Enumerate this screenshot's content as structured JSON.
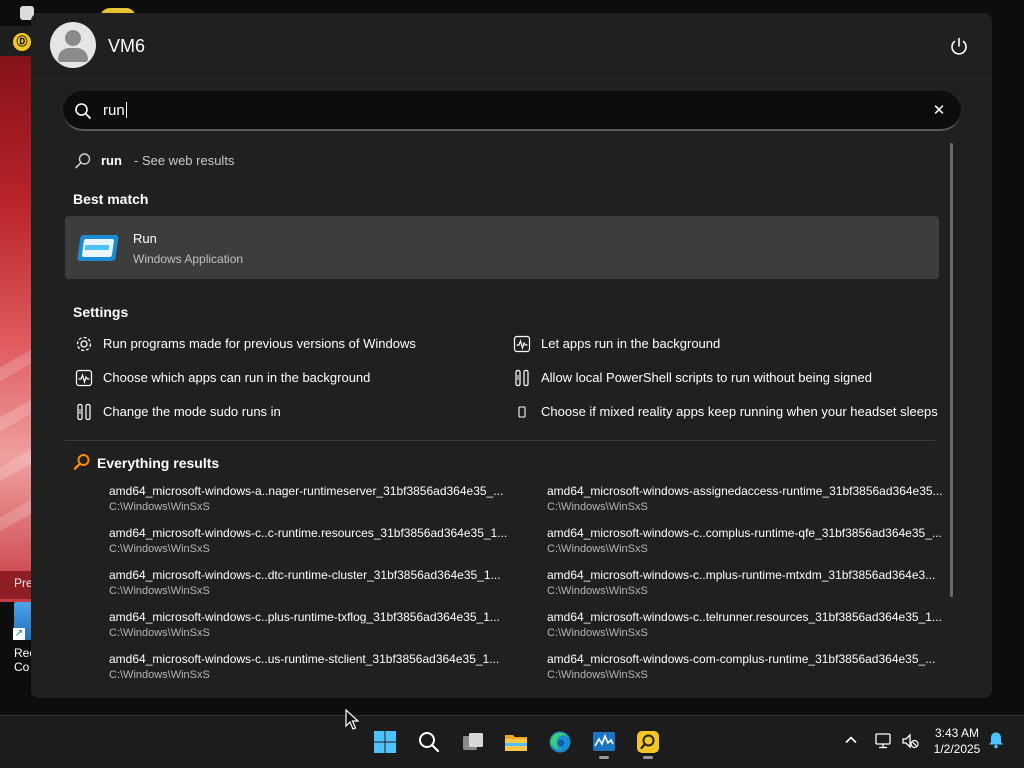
{
  "desktop": {
    "app_footer_text": "Pre",
    "shortcut_label": "Rec Co"
  },
  "user": {
    "name": "VM6"
  },
  "search": {
    "query": "run"
  },
  "web_result": {
    "query": "run",
    "suffix": "- See web results"
  },
  "best_match": {
    "title": "Best match",
    "name": "Run",
    "type": "Windows Application"
  },
  "settings": {
    "title": "Settings",
    "items": [
      {
        "label": "Run programs made for previous versions of Windows",
        "icon": "gear-icon"
      },
      {
        "label": "Let apps run in the background",
        "icon": "pulse-icon"
      },
      {
        "label": "Choose which apps can run in the background",
        "icon": "pulse-icon"
      },
      {
        "label": "Allow local PowerShell scripts to run without being signed",
        "icon": "tools-icon"
      },
      {
        "label": "Change the mode sudo runs in",
        "icon": "tools-icon"
      },
      {
        "label": "Choose if mixed reality apps keep running when your headset sleeps",
        "icon": "phone-icon"
      }
    ]
  },
  "everything": {
    "title": "Everything results",
    "results": [
      {
        "name": "amd64_microsoft-windows-a..nager-runtimeserver_31bf3856ad364e35_...",
        "path": "C:\\Windows\\WinSxS"
      },
      {
        "name": "amd64_microsoft-windows-assignedaccess-runtime_31bf3856ad364e35...",
        "path": "C:\\Windows\\WinSxS"
      },
      {
        "name": "amd64_microsoft-windows-c..c-runtime.resources_31bf3856ad364e35_1...",
        "path": "C:\\Windows\\WinSxS"
      },
      {
        "name": "amd64_microsoft-windows-c..complus-runtime-qfe_31bf3856ad364e35_...",
        "path": "C:\\Windows\\WinSxS"
      },
      {
        "name": "amd64_microsoft-windows-c..dtc-runtime-cluster_31bf3856ad364e35_1...",
        "path": "C:\\Windows\\WinSxS"
      },
      {
        "name": "amd64_microsoft-windows-c..mplus-runtime-mtxdm_31bf3856ad364e3...",
        "path": "C:\\Windows\\WinSxS"
      },
      {
        "name": "amd64_microsoft-windows-c..plus-runtime-txflog_31bf3856ad364e35_1...",
        "path": "C:\\Windows\\WinSxS"
      },
      {
        "name": "amd64_microsoft-windows-c..telrunner.resources_31bf3856ad364e35_1...",
        "path": "C:\\Windows\\WinSxS"
      },
      {
        "name": "amd64_microsoft-windows-c..us-runtime-stclient_31bf3856ad364e35_1...",
        "path": "C:\\Windows\\WinSxS"
      },
      {
        "name": "amd64_microsoft-windows-com-complus-runtime_31bf3856ad364e35_...",
        "path": "C:\\Windows\\WinSxS"
      }
    ]
  },
  "taskbar": {
    "apps": [
      "windows-start-icon",
      "search-icon",
      "task-view-icon",
      "file-explorer-icon",
      "edge-browser-icon",
      "task-manager-icon",
      "everything-search-icon"
    ],
    "clock_time": "3:43 AM",
    "clock_date": "1/2/2025"
  },
  "colors": {
    "panel_bg": "#202020",
    "highlight": "#3d3d3d",
    "search_bg": "#0c0c0c",
    "accent_blue": "#4cc2ff",
    "everything_orange": "#ff8a00"
  }
}
